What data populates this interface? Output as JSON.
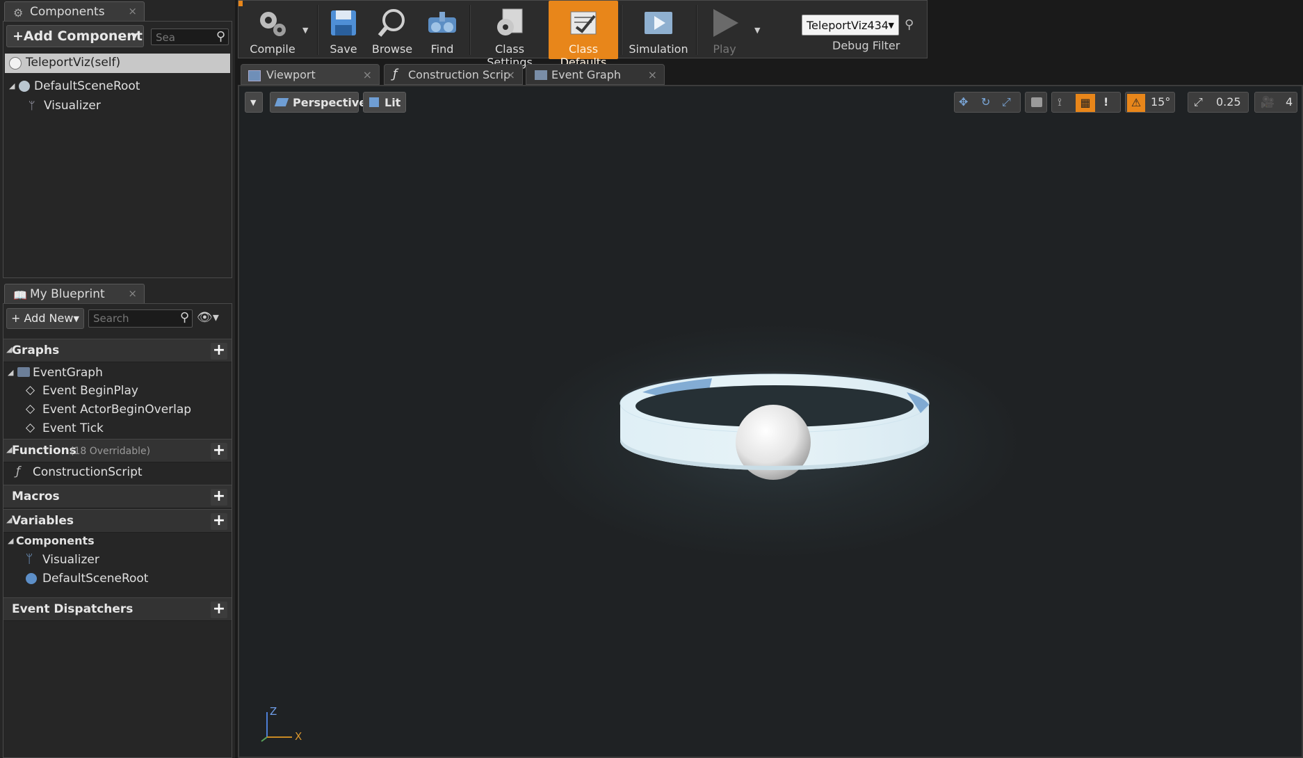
{
  "components_panel": {
    "tab_title": "Components",
    "tab_close": "×",
    "add_component_label": "+Add Component",
    "search_placeholder": "Sea",
    "self_item": "TeleportViz(self)",
    "tree": [
      {
        "label": "DefaultSceneRoot",
        "icon": "scene-root-icon"
      },
      {
        "label": "Visualizer",
        "icon": "visualizer-icon"
      }
    ]
  },
  "my_blueprint": {
    "tab_title": "My Blueprint",
    "tab_close": "×",
    "add_new_label": "+ Add New",
    "search_placeholder": "Search",
    "sections": {
      "graphs": {
        "label": "Graphs",
        "items": [
          "EventGraph",
          "Event BeginPlay",
          "Event ActorBeginOverlap",
          "Event Tick"
        ]
      },
      "functions": {
        "label": "Functions",
        "note": "(18 Overridable)",
        "items": [
          "ConstructionScript"
        ]
      },
      "macros": {
        "label": "Macros"
      },
      "variables": {
        "label": "Variables",
        "subsection": "Components",
        "items": [
          "Visualizer",
          "DefaultSceneRoot"
        ]
      },
      "dispatchers": {
        "label": "Event Dispatchers"
      }
    }
  },
  "toolbar": {
    "compile": "Compile",
    "save": "Save",
    "browse": "Browse",
    "find": "Find",
    "class_settings": "Class Settings",
    "class_defaults": "Class Defaults",
    "simulation": "Simulation",
    "play": "Play",
    "debug_object": "TeleportViz434",
    "debug_filter": "Debug Filter"
  },
  "doc_tabs": [
    {
      "label": "Viewport",
      "icon": "viewport-icon"
    },
    {
      "label": "Construction Scrip",
      "icon": "function-icon"
    },
    {
      "label": "Event Graph",
      "icon": "graph-icon"
    }
  ],
  "viewport": {
    "perspective": "Perspective",
    "lit": "Lit",
    "rotation_snap": "15°",
    "scale_snap": "0.25",
    "camera_speed": "4",
    "axis_z": "Z",
    "axis_x": "X"
  },
  "colors": {
    "accent_orange": "#e8861a",
    "panel_bg": "#262626",
    "viewport_bg": "#222628"
  }
}
